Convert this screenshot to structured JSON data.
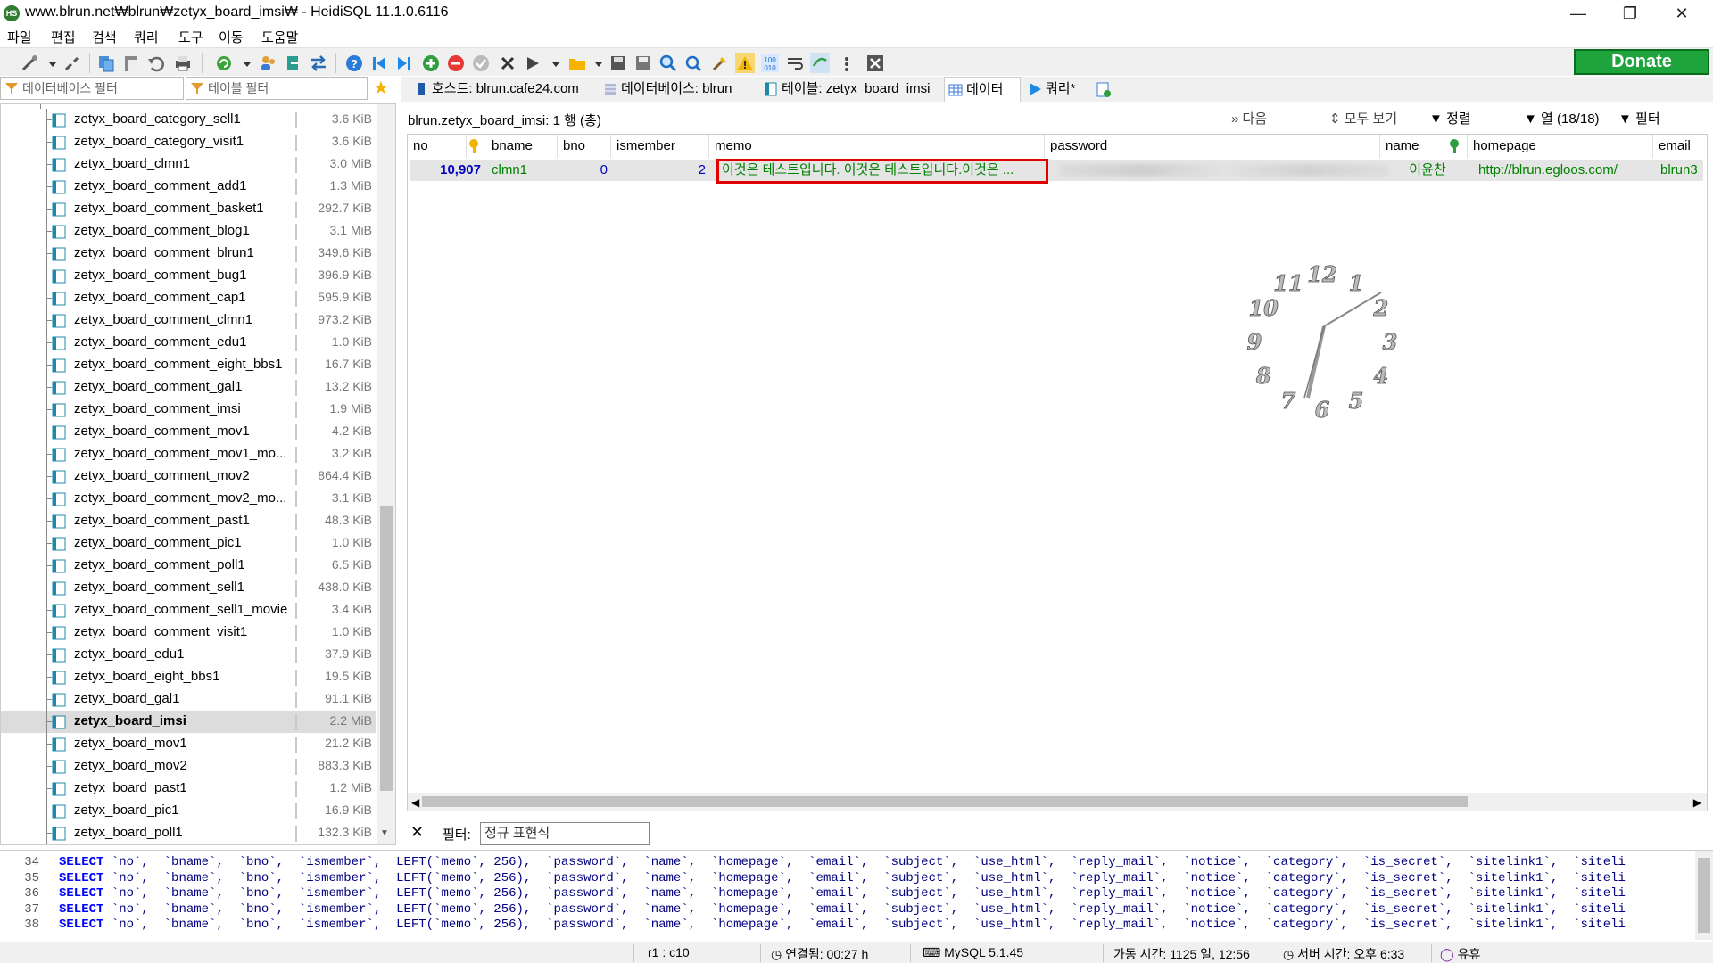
{
  "window": {
    "title": "www.blrun.net₩blrun₩zetyx_board_imsi₩ - HeidiSQL 11.1.0.6116",
    "app_icon": "HS"
  },
  "menu": [
    "파일",
    "편집",
    "검색",
    "쿼리",
    "도구",
    "이동",
    "도움말"
  ],
  "toolbar": {
    "donate_label": "Donate",
    "icons": [
      "connect-icon",
      "disconnect-icon",
      "copy-icon",
      "paste-icon",
      "undo-icon",
      "print-icon",
      "refresh-icon",
      "user-manager-icon",
      "export-icon",
      "transfer-icon",
      "help-icon",
      "first-record-icon",
      "last-record-icon",
      "add-record-icon",
      "delete-record-icon",
      "post-icon",
      "cancel-icon",
      "run-icon",
      "open-file-icon",
      "save-icon",
      "save-as-icon",
      "find-icon",
      "replace-icon",
      "format-icon",
      "warning-icon",
      "binary-icon",
      "wrap-icon",
      "sync-icon",
      "more-icon",
      "stop-icon"
    ]
  },
  "filters": {
    "db_filter_placeholder": "데이터베이스 필터",
    "table_filter_placeholder": "테이블 필터"
  },
  "tabs": [
    {
      "label": "호스트: blrun.cafe24.com",
      "icon": "host-icon"
    },
    {
      "label": "데이터베이스: blrun",
      "icon": "database-icon"
    },
    {
      "label": "테이블: zetyx_board_imsi",
      "icon": "table-icon"
    },
    {
      "label": "데이터",
      "icon": "grid-icon"
    },
    {
      "label": "쿼리*",
      "icon": "play-icon"
    }
  ],
  "tree": [
    {
      "name": "zetyx_board_category_sell1",
      "size": "3.6 KiB"
    },
    {
      "name": "zetyx_board_category_visit1",
      "size": "3.6 KiB"
    },
    {
      "name": "zetyx_board_clmn1",
      "size": "3.0 MiB"
    },
    {
      "name": "zetyx_board_comment_add1",
      "size": "1.3 MiB"
    },
    {
      "name": "zetyx_board_comment_basket1",
      "size": "292.7 KiB"
    },
    {
      "name": "zetyx_board_comment_blog1",
      "size": "3.1 MiB"
    },
    {
      "name": "zetyx_board_comment_blrun1",
      "size": "349.6 KiB"
    },
    {
      "name": "zetyx_board_comment_bug1",
      "size": "396.9 KiB"
    },
    {
      "name": "zetyx_board_comment_cap1",
      "size": "595.9 KiB"
    },
    {
      "name": "zetyx_board_comment_clmn1",
      "size": "973.2 KiB"
    },
    {
      "name": "zetyx_board_comment_edu1",
      "size": "1.0 KiB"
    },
    {
      "name": "zetyx_board_comment_eight_bbs1",
      "size": "16.7 KiB"
    },
    {
      "name": "zetyx_board_comment_gal1",
      "size": "13.2 KiB"
    },
    {
      "name": "zetyx_board_comment_imsi",
      "size": "1.9 MiB"
    },
    {
      "name": "zetyx_board_comment_mov1",
      "size": "4.2 KiB"
    },
    {
      "name": "zetyx_board_comment_mov1_mo...",
      "size": "3.2 KiB"
    },
    {
      "name": "zetyx_board_comment_mov2",
      "size": "864.4 KiB"
    },
    {
      "name": "zetyx_board_comment_mov2_mo...",
      "size": "3.1 KiB"
    },
    {
      "name": "zetyx_board_comment_past1",
      "size": "48.3 KiB"
    },
    {
      "name": "zetyx_board_comment_pic1",
      "size": "1.0 KiB"
    },
    {
      "name": "zetyx_board_comment_poll1",
      "size": "6.5 KiB"
    },
    {
      "name": "zetyx_board_comment_sell1",
      "size": "438.0 KiB"
    },
    {
      "name": "zetyx_board_comment_sell1_movie",
      "size": "3.4 KiB"
    },
    {
      "name": "zetyx_board_comment_visit1",
      "size": "1.0 KiB"
    },
    {
      "name": "zetyx_board_edu1",
      "size": "37.9 KiB"
    },
    {
      "name": "zetyx_board_eight_bbs1",
      "size": "19.5 KiB"
    },
    {
      "name": "zetyx_board_gal1",
      "size": "91.1 KiB"
    },
    {
      "name": "zetyx_board_imsi",
      "size": "2.2 MiB",
      "selected": true
    },
    {
      "name": "zetyx_board_mov1",
      "size": "21.2 KiB"
    },
    {
      "name": "zetyx_board_mov2",
      "size": "883.3 KiB"
    },
    {
      "name": "zetyx_board_past1",
      "size": "1.2 MiB"
    },
    {
      "name": "zetyx_board_pic1",
      "size": "16.9 KiB"
    },
    {
      "name": "zetyx_board_poll1",
      "size": "132.3 KiB"
    }
  ],
  "grid": {
    "title": "blrun.zetyx_board_imsi: 1 행 (총)",
    "next_label": "다음",
    "show_all_label": "모두 보기",
    "sort_label": "정렬",
    "columns_label": "열 (18/18)",
    "filter_label": "필터",
    "headers": [
      "no",
      "bname",
      "bno",
      "ismember",
      "memo",
      "password",
      "name",
      "homepage",
      "email"
    ],
    "row": {
      "no": "10,907",
      "bname": "clmn1",
      "bno": "0",
      "ismember": "2",
      "memo": "이것은 테스트입니다. 이것은 테스트입니다.이것은 ...",
      "name": "이윤찬",
      "homepage": "http://blrun.egloos.com/",
      "email": "blrun3"
    }
  },
  "clock": {
    "numbers": [
      "12",
      "1",
      "2",
      "3",
      "4",
      "5",
      "6",
      "7",
      "8",
      "9",
      "10",
      "11"
    ]
  },
  "grid_filter": {
    "label": "필터:",
    "placeholder": "정규 표현식"
  },
  "sql_log": {
    "lines": [
      {
        "n": "34",
        "code": "`no`,  `bname`,  `bno`,  `ismember`,  LEFT(`memo`, 256),  `password`,  `name`,  `homepage`,  `email`,  `subject`,  `use_html`,  `reply_mail`,  `notice`,  `category`,  `is_secret`,  `sitelink1`,  `siteli"
      },
      {
        "n": "35",
        "code": "`no`,  `bname`,  `bno`,  `ismember`,  LEFT(`memo`, 256),  `password`,  `name`,  `homepage`,  `email`,  `subject`,  `use_html`,  `reply_mail`,  `notice`,  `category`,  `is_secret`,  `sitelink1`,  `siteli"
      },
      {
        "n": "36",
        "code": "`no`,  `bname`,  `bno`,  `ismember`,  LEFT(`memo`, 256),  `password`,  `name`,  `homepage`,  `email`,  `subject`,  `use_html`,  `reply_mail`,  `notice`,  `category`,  `is_secret`,  `sitelink1`,  `siteli"
      },
      {
        "n": "37",
        "code": "`no`,  `bname`,  `bno`,  `ismember`,  LEFT(`memo`, 256),  `password`,  `name`,  `homepage`,  `email`,  `subject`,  `use_html`,  `reply_mail`,  `notice`,  `category`,  `is_secret`,  `sitelink1`,  `siteli"
      },
      {
        "n": "38",
        "code": "`no`,  `bname`,  `bno`,  `ismember`,  LEFT(`memo`, 256),  `password`,  `name`,  `homepage`,  `email`,  `subject`,  `use_html`,  `reply_mail`,  `notice`,  `category`,  `is_secret`,  `sitelink1`,  `siteli"
      }
    ],
    "keyword": "SELECT"
  },
  "status": {
    "cursor": "r1 : c10",
    "connected": "연결됨: 00:27 h",
    "server": "MySQL 5.1.45",
    "uptime": "가동 시간: 1125 일, 12:56",
    "server_time": "서버 시간: 오후 6:33",
    "idle": "유휴"
  },
  "colors": {
    "donate": "#1fa33d",
    "number": "#0000c0",
    "text_value": "#008000",
    "highlight": "#e00000"
  }
}
